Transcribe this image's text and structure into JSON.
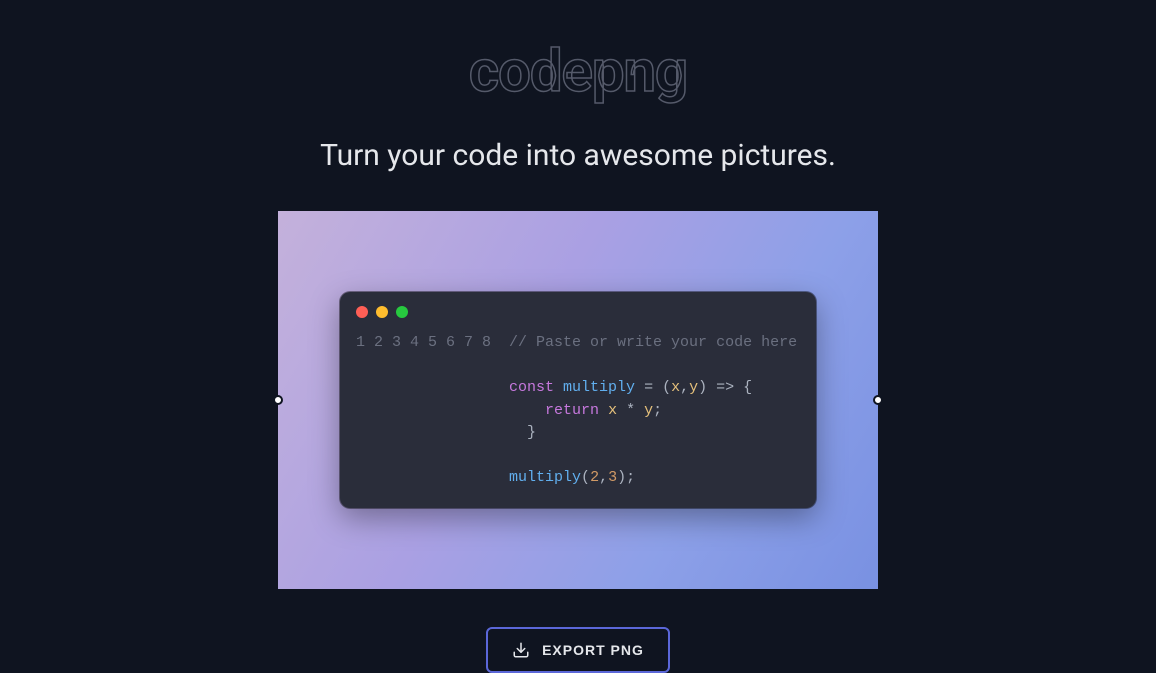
{
  "brand": "codepng",
  "tagline": "Turn your code into awesome pictures.",
  "editor": {
    "lineStart": 1,
    "lineCount": 8,
    "code": {
      "l1_comment": "// Paste or write your code here",
      "l3_kw": "const ",
      "l3_fn": "multiply",
      "l3_eq": " = (",
      "l3_x": "x",
      "l3_comma": ",",
      "l3_y": "y",
      "l3_arrow": ") => {",
      "l4_indent": "    ",
      "l4_kw": "return ",
      "l4_x": "x",
      "l4_star": " * ",
      "l4_y": "y",
      "l4_semi": ";",
      "l5_brace": "  }",
      "l7_fn": "multiply",
      "l7_open": "(",
      "l7_a": "2",
      "l7_comma": ",",
      "l7_b": "3",
      "l7_close": ");"
    }
  },
  "exportLabel": "EXPORT PNG"
}
